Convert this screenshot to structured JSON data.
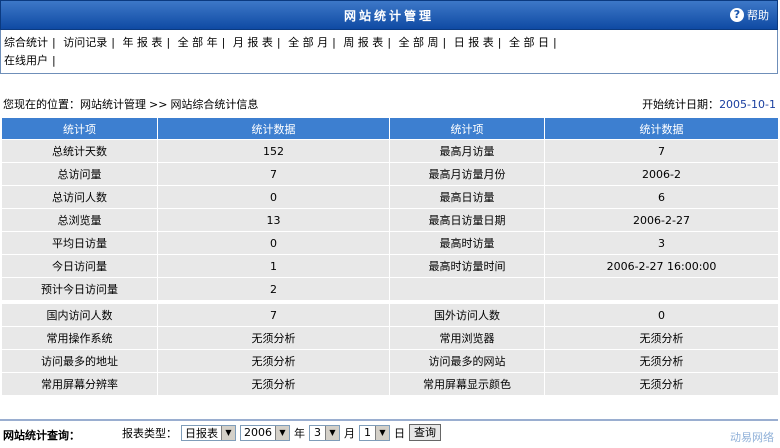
{
  "header": {
    "title": "网站统计管理",
    "help_label": "帮助",
    "help_icon": "question-icon"
  },
  "nav": {
    "row1": [
      "综合统计",
      "访问记录",
      "年 报 表",
      "全 部 年",
      "月 报 表",
      "全 部 月",
      "周 报 表",
      "全 部 周",
      "日 报 表",
      "全 部 日"
    ],
    "row2": [
      "在线用户"
    ]
  },
  "location": {
    "prefix": "您现在的位置：",
    "section": "网站统计管理",
    "arrow": ">>",
    "page": "网站综合统计信息"
  },
  "start": {
    "label": "开始统计日期：",
    "date": "2005-10-1"
  },
  "table": {
    "headers": [
      "统计项",
      "统计数据",
      "统计项",
      "统计数据"
    ],
    "group1": [
      [
        "总统计天数",
        "152",
        "最高月访量",
        "7"
      ],
      [
        "总访问量",
        "7",
        "最高月访量月份",
        "2006-2"
      ],
      [
        "总访问人数",
        "0",
        "最高日访量",
        "6"
      ],
      [
        "总浏览量",
        "13",
        "最高日访量日期",
        "2006-2-27"
      ],
      [
        "平均日访量",
        "0",
        "最高时访量",
        "3"
      ],
      [
        "今日访问量",
        "1",
        "最高时访量时间",
        "2006-2-27 16:00:00"
      ],
      [
        "预计今日访问量",
        "2",
        "",
        ""
      ]
    ],
    "group2": [
      [
        "国内访问人数",
        "7",
        "国外访问人数",
        "0"
      ],
      [
        "常用操作系统",
        "无须分析",
        "常用浏览器",
        "无须分析"
      ],
      [
        "访问最多的地址",
        "无须分析",
        "访问最多的网站",
        "无须分析"
      ],
      [
        "常用屏幕分辨率",
        "无须分析",
        "常用屏幕显示颜色",
        "无须分析"
      ]
    ]
  },
  "query": {
    "label": "网站统计查询：",
    "type_label": "报表类型：",
    "type_value": "日报表",
    "year_value": "2006",
    "year_unit": "年",
    "month_value": "3",
    "month_unit": "月",
    "day_value": "1",
    "day_unit": "日",
    "submit_label": "查询"
  },
  "watermark": "动易网络"
}
